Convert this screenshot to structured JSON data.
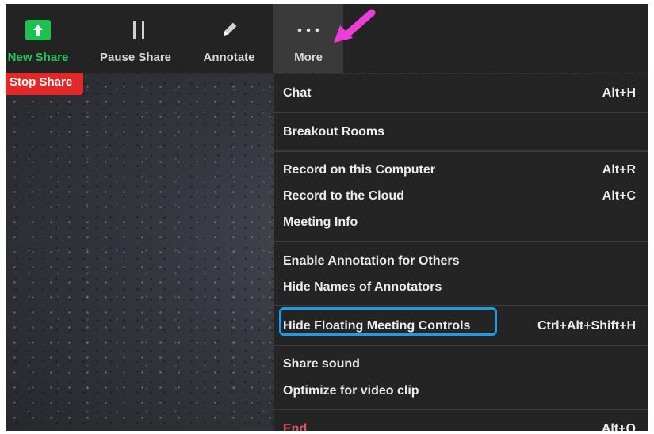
{
  "toolbar": {
    "new_share": {
      "label": "New Share",
      "icon": "arrow-up-icon"
    },
    "pause_share": {
      "label": "Pause Share",
      "icon": "pause-icon"
    },
    "annotate": {
      "label": "Annotate",
      "icon": "pencil-icon"
    },
    "more": {
      "label": "More",
      "icon": "ellipsis-icon"
    }
  },
  "stop_share": {
    "label": "Stop Share"
  },
  "menu": {
    "chat": {
      "label": "Chat",
      "shortcut": "Alt+H"
    },
    "breakout_rooms": {
      "label": "Breakout Rooms"
    },
    "record_computer": {
      "label": "Record on this Computer",
      "shortcut": "Alt+R"
    },
    "record_cloud": {
      "label": "Record to the Cloud",
      "shortcut": "Alt+C"
    },
    "meeting_info": {
      "label": "Meeting Info"
    },
    "enable_annotation": {
      "label": "Enable Annotation for Others"
    },
    "hide_names": {
      "label": "Hide Names of Annotators"
    },
    "hide_floating": {
      "label": "Hide Floating Meeting Controls",
      "shortcut": "Ctrl+Alt+Shift+H"
    },
    "share_sound": {
      "label": "Share sound"
    },
    "optimize_video": {
      "label": "Optimize for video clip"
    },
    "end": {
      "label": "End",
      "shortcut": "Alt+Q"
    }
  },
  "colors": {
    "share_green": "#1fbf50",
    "stop_red": "#e22828",
    "highlight_blue": "#1e9be6",
    "pointer_arrow": "#ee3dd8",
    "end_red": "#e25555"
  }
}
